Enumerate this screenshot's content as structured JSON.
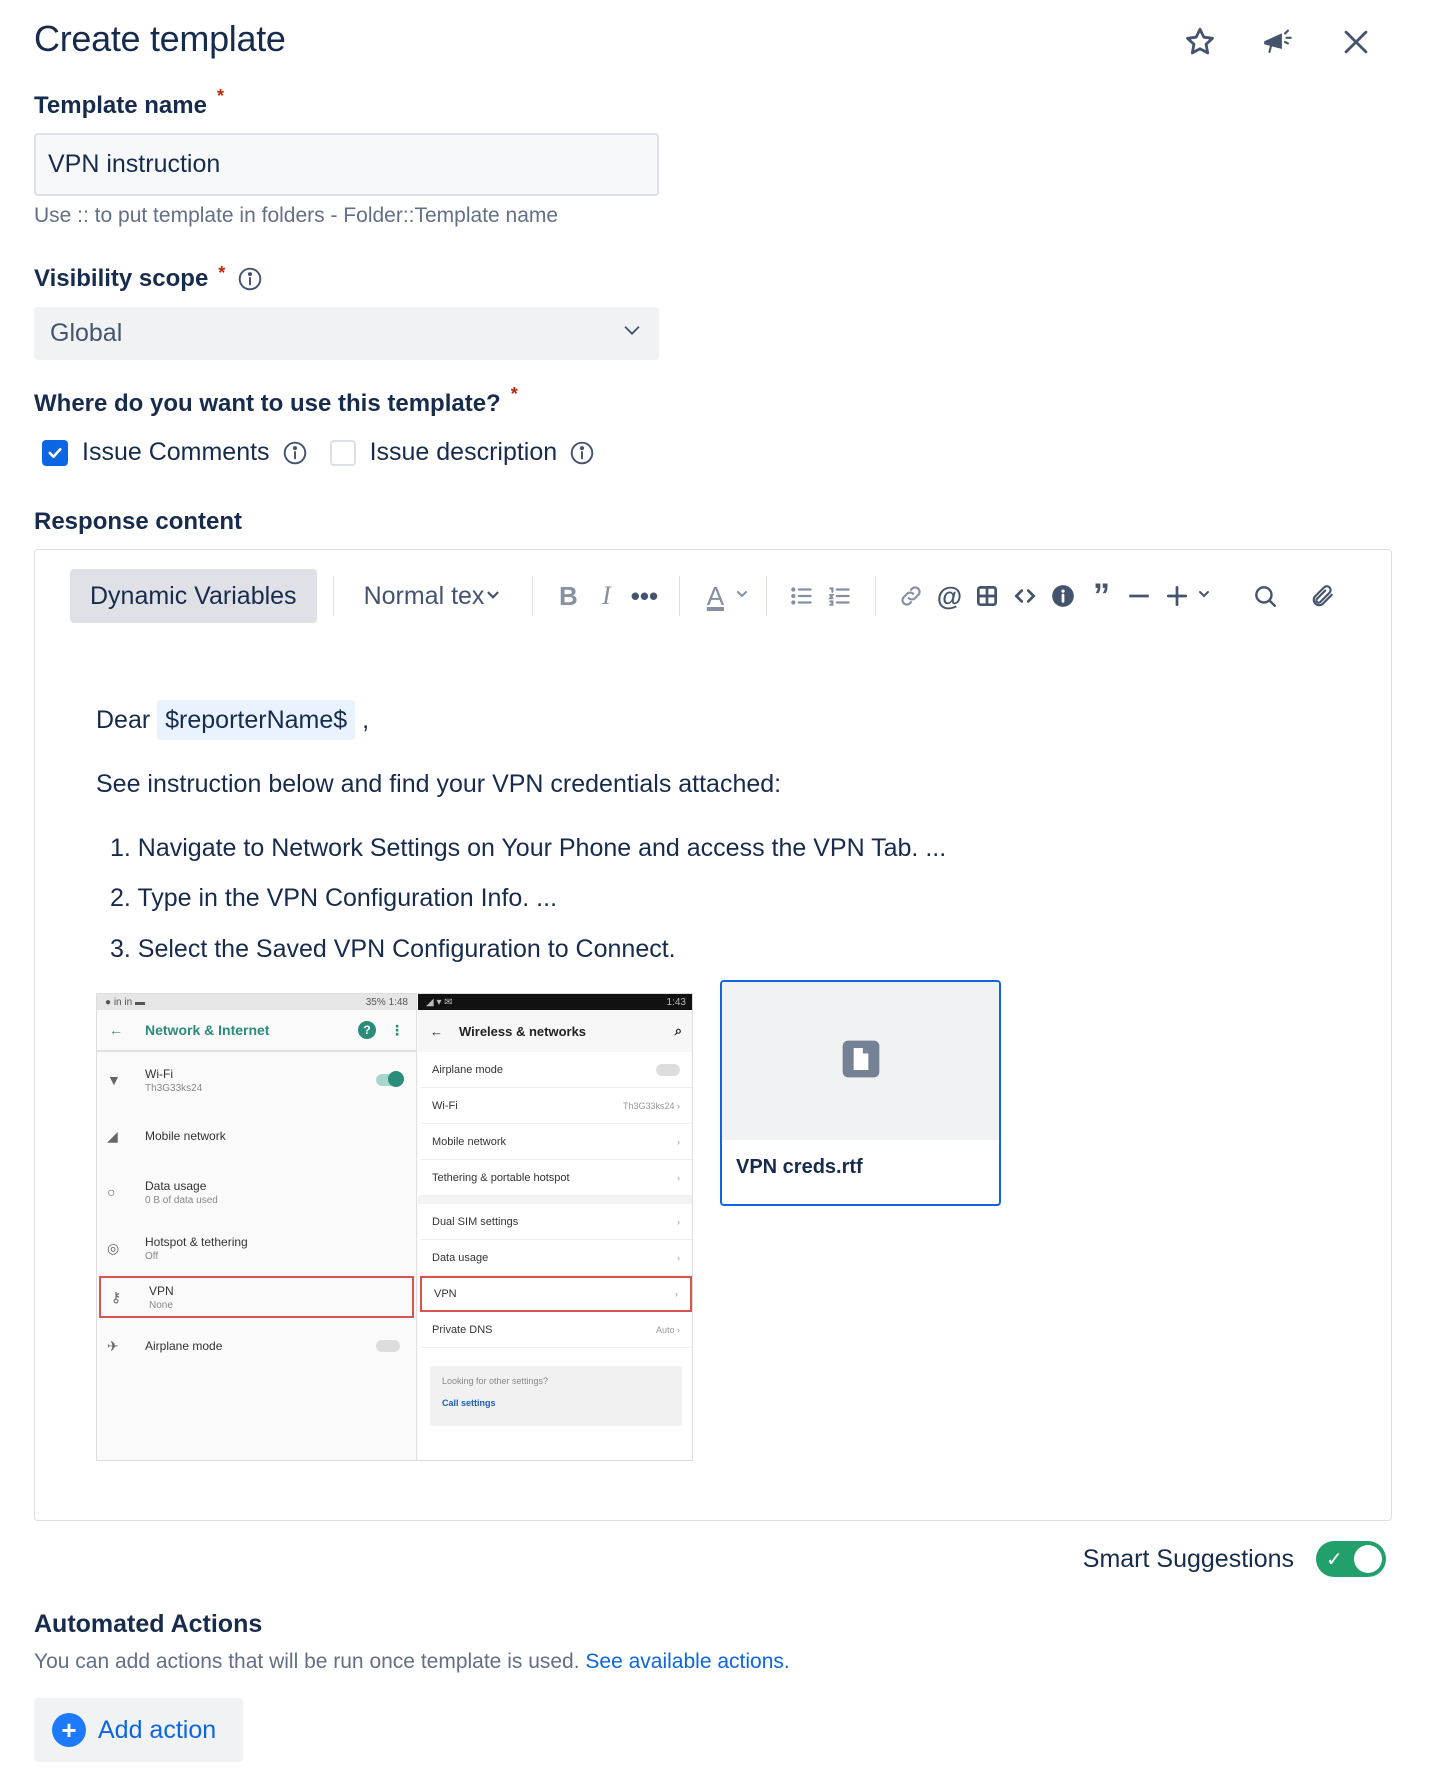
{
  "header": {
    "title": "Create template",
    "icons": [
      "star-icon",
      "megaphone-icon",
      "close-icon"
    ]
  },
  "template_name": {
    "label": "Template name",
    "required_mark": "*",
    "value": "VPN instruction",
    "helper": "Use :: to put template in folders - Folder::Template name"
  },
  "visibility": {
    "label": "Visibility scope",
    "required_mark": "*",
    "selected": "Global"
  },
  "usage": {
    "label": "Where do you want to use this template?",
    "required_mark": "*",
    "options": [
      {
        "label": "Issue Comments",
        "checked": true
      },
      {
        "label": "Issue description",
        "checked": false
      }
    ]
  },
  "response": {
    "label": "Response content",
    "toolbar": {
      "dynamic_variables": "Dynamic Variables",
      "text_style": "Normal tex"
    },
    "body": {
      "greeting": "Dear",
      "variable": "$reporterName$",
      "greeting_suffix": ",",
      "intro": "See instruction below and find your VPN credentials attached:",
      "steps": [
        "1. Navigate to Network Settings on Your Phone and access the VPN Tab. ...",
        "2. Type in the VPN Configuration Info. ...",
        "3. Select the Saved VPN Configuration to Connect."
      ]
    },
    "embedded_screenshot": {
      "left": {
        "status_left": "● in in ▬",
        "status_right": "35% 1:48",
        "title": "Network & Internet",
        "rows": [
          {
            "title": "Wi-Fi",
            "sub": "Th3G33ks24"
          },
          {
            "title": "Mobile network",
            "sub": ""
          },
          {
            "title": "Data usage",
            "sub": "0 B of data used"
          },
          {
            "title": "Hotspot & tethering",
            "sub": "Off"
          },
          {
            "title": "VPN",
            "sub": "None"
          },
          {
            "title": "Airplane mode",
            "sub": ""
          }
        ]
      },
      "right": {
        "status_right": "1:43",
        "title": "Wireless & networks",
        "rows": [
          {
            "title": "Airplane mode",
            "val": ""
          },
          {
            "title": "Wi-Fi",
            "val": "Th3G33ks24 ›"
          },
          {
            "title": "Mobile network",
            "val": "›"
          },
          {
            "title": "Tethering & portable hotspot",
            "val": "›"
          },
          {
            "title": "Dual SIM settings",
            "val": "›"
          },
          {
            "title": "Data usage",
            "val": "›"
          },
          {
            "title": "VPN",
            "val": "›"
          },
          {
            "title": "Private DNS",
            "val": "Auto ›"
          }
        ],
        "box_text": "Looking for other settings?",
        "box_link": "Call settings"
      }
    },
    "attachment": {
      "file_name": "VPN creds.rtf"
    }
  },
  "smart_suggestions": {
    "label": "Smart Suggestions",
    "enabled": true
  },
  "automated_actions": {
    "title": "Automated Actions",
    "description": "You can add actions that will be run once template is used.",
    "link": "See available actions.",
    "add_button": "Add action"
  }
}
